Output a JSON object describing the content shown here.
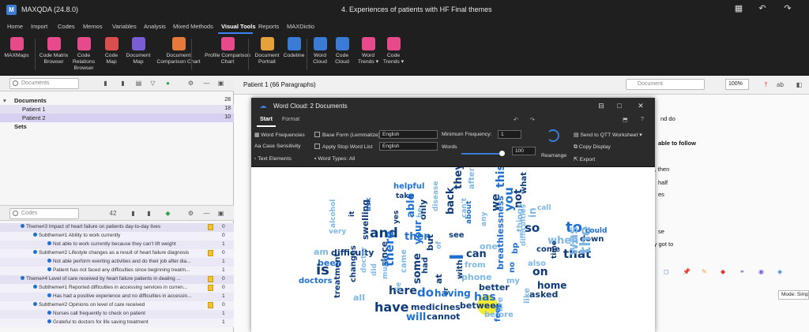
{
  "app": {
    "title": "MAXQDA (24.8.0)",
    "logo": "M",
    "document_title": "4. Experiences of patients with HF Final themes"
  },
  "menu": [
    "Home",
    "Import",
    "Codes",
    "Memos",
    "Variables",
    "Analysis",
    "Mixed Methods",
    "Visual Tools",
    "Reports",
    "MAXDictio"
  ],
  "menu_active": "Visual Tools",
  "ribbon": [
    {
      "label": "MAXMaps",
      "icon": "maxmaps-icon",
      "color": "#e64a8a"
    },
    {
      "label": "Code Matrix\nBrowser",
      "icon": "code-matrix-icon",
      "color": "#e64a8a"
    },
    {
      "label": "Code Relations\nBrowser",
      "icon": "code-relations-icon",
      "color": "#e64a8a"
    },
    {
      "label": "Code\nMap",
      "icon": "code-map-icon",
      "color": "#d94f4f"
    },
    {
      "label": "Document\nMap",
      "icon": "document-map-icon",
      "color": "#7a5cd6"
    },
    {
      "label": "Document\nComparison Chart",
      "icon": "comparison-chart-icon",
      "color": "#e57a3a"
    },
    {
      "label": "Profile Comparison\nChart",
      "icon": "profile-comparison-icon",
      "color": "#e64a8a"
    },
    {
      "label": "Document\nPortrait",
      "icon": "document-portrait-icon",
      "color": "#e6a23a"
    },
    {
      "label": "Codeline",
      "icon": "codeline-icon",
      "color": "#3a7bd5"
    },
    {
      "label": "Word\nCloud",
      "icon": "word-cloud-icon",
      "color": "#3a7bd5"
    },
    {
      "label": "Code\nCloud",
      "icon": "code-cloud-icon",
      "color": "#3a7bd5"
    },
    {
      "label": "Word\nTrends ▾",
      "icon": "word-trends-icon",
      "color": "#e64a8a"
    },
    {
      "label": "Code\nTrends ▾",
      "icon": "code-trends-icon",
      "color": "#e64a8a"
    }
  ],
  "documents": {
    "search_placeholder": "Documents",
    "root": {
      "label": "Documents",
      "count": "28"
    },
    "items": [
      {
        "label": "Patient 1",
        "count": "18"
      },
      {
        "label": "Patient 2",
        "count": "10"
      }
    ],
    "sets": "Sets"
  },
  "codes": {
    "search_placeholder": "Codes",
    "badge": "42",
    "rows": [
      {
        "label": "Theme#3 Impact of heart failure on patients day-to-day lives",
        "count": "0",
        "indent": 1,
        "memo": true
      },
      {
        "label": "Subtheme#1 Ability to work currently",
        "count": "0",
        "indent": 2,
        "memo": false
      },
      {
        "label": "Not able to work currently because they can't lift weight",
        "count": "1",
        "indent": 3,
        "memo": false
      },
      {
        "label": "Subtheme#2 Lifestyle changes as a result of heart failure diagnosis",
        "count": "0",
        "indent": 2,
        "memo": true
      },
      {
        "label": "Not able perform everting activities and do their job after dia...",
        "count": "1",
        "indent": 3,
        "memo": false
      },
      {
        "label": "Patient has not faced any difficulties since beginning treatm...",
        "count": "1",
        "indent": 3,
        "memo": false
      },
      {
        "label": "Theme#4 Level of care received  by heart failure patients in  dealing ...",
        "count": "0",
        "indent": 1,
        "memo": true
      },
      {
        "label": "Subtheme#1 Reported difficulties in accessing services in curren...",
        "count": "0",
        "indent": 2,
        "memo": true
      },
      {
        "label": "Has had a positive experience and no difficulties in accessin...",
        "count": "1",
        "indent": 3,
        "memo": false
      },
      {
        "label": "Subtheme#2 Opinions on level of care received",
        "count": "0",
        "indent": 2,
        "memo": true
      },
      {
        "label": "Nurses call frequently to check on patient",
        "count": "1",
        "indent": 3,
        "memo": false
      },
      {
        "label": "Grateful to doctors for life saving treatment",
        "count": "1",
        "indent": 3,
        "memo": false
      }
    ]
  },
  "doc_view": {
    "title": "Patient 1  (66 Paragraphs)",
    "search_placeholder": "Document",
    "zoom": "100%",
    "snippets": [
      "nd do",
      "able to follow",
      "), then",
      "half",
      "es",
      "se",
      "ly got to"
    ],
    "mode": "Mode: Simp"
  },
  "word_cloud": {
    "title": "Word Cloud: 2 Documents",
    "tabs": [
      "Start",
      "Format"
    ],
    "active_tab": "Start",
    "word_frequencies": "Word Frequencies",
    "case_sensitivity": "Case Sensitivity",
    "text_elements": "Text Elements",
    "base_form": "Base Form (Lemmatize)",
    "stop_list": "Apply Stop Word List",
    "lang1": "English",
    "lang2": "English",
    "word_types": "Word Types: All",
    "min_freq_label": "Minimum Frequency:",
    "min_freq": "1",
    "words_label": "Words",
    "words": "100",
    "rearrange": "Rearrange",
    "send_qtt": "Send to QTT Worksheet",
    "copy_display": "Copy Display",
    "export": "Export",
    "words_list": [
      [
        "helpful",
        "#1f6fd1"
      ],
      [
        "take",
        "#0d3b7a"
      ],
      [
        "able",
        "#1f6fd1"
      ],
      [
        "only",
        "#0d3b7a"
      ],
      [
        "disease",
        "#7fb8e6"
      ],
      [
        "back",
        "#0d3b7a"
      ],
      [
        "they",
        "#0d3b7a"
      ],
      [
        "after",
        "#7fb8e6"
      ],
      [
        "this",
        "#1f6fd1"
      ],
      [
        "what",
        "#0d3b7a"
      ],
      [
        "call",
        "#7fb8e6"
      ],
      [
        "alcohol",
        "#7fb8e6"
      ],
      [
        "it",
        "#0d3b7a"
      ],
      [
        "ask",
        "#1f6fd1"
      ],
      [
        "yes",
        "#0d3b7a"
      ],
      [
        "be",
        "#7fb8e6"
      ],
      [
        "can't",
        "#7fb8e6"
      ],
      [
        "about",
        "#1f6fd1"
      ],
      [
        "any",
        "#7fb8e6"
      ],
      [
        "we",
        "#0d3b7a"
      ],
      [
        "you",
        "#1f6fd1"
      ],
      [
        "not",
        "#0d3b7a"
      ],
      [
        "in",
        "#7fb8e6"
      ],
      [
        "very",
        "#7fb8e6"
      ],
      [
        "swelling",
        "#0d3b7a"
      ],
      [
        "and",
        "#0d3b7a"
      ],
      [
        "then",
        "#1f6fd1"
      ],
      [
        "see",
        "#0d3b7a"
      ],
      [
        "so",
        "#0d3b7a"
      ],
      [
        "to",
        "#1f6fd1"
      ],
      [
        "difficulty",
        "#0d3b7a"
      ],
      [
        "been",
        "#1f6fd1"
      ],
      [
        "your",
        "#1f6fd1"
      ],
      [
        "but",
        "#0d3b7a"
      ],
      [
        "of",
        "#7fb8e6"
      ],
      [
        "I",
        "#1f6fd1"
      ],
      [
        "can",
        "#0d3b7a"
      ],
      [
        "when",
        "#7fb8e6"
      ],
      [
        "down",
        "#0d3b7a"
      ],
      [
        "am",
        "#7fb8e6"
      ],
      [
        "that",
        "#0d3b7a"
      ],
      [
        "come",
        "#0d3b7a"
      ],
      [
        "is",
        "#0d3b7a"
      ],
      [
        "changes",
        "#0d3b7a"
      ],
      [
        "doctor",
        "#7fb8e6"
      ],
      [
        "since",
        "#0d3b7a"
      ],
      [
        "the",
        "#7fb8e6"
      ],
      [
        "was",
        "#7fb8e6"
      ],
      [
        "doctors",
        "#1f6fd1"
      ],
      [
        "treatment",
        "#0d3b7a"
      ],
      [
        "there",
        "#1f6fd1"
      ],
      [
        "came",
        "#7fb8e6"
      ],
      [
        "some",
        "#0d3b7a"
      ],
      [
        "had",
        "#0d3b7a"
      ],
      [
        "from",
        "#7fb8e6"
      ],
      [
        "on",
        "#0d3b7a"
      ],
      [
        "also",
        "#7fb8e6"
      ],
      [
        "no",
        "#1f6fd1"
      ],
      [
        "home",
        "#0d3b7a"
      ],
      [
        "or",
        "#0d3b7a"
      ],
      [
        "here",
        "#0d3b7a"
      ],
      [
        "do",
        "#1f6fd1"
      ],
      [
        "having",
        "#1f6fd1"
      ],
      [
        "phone",
        "#7fb8e6"
      ],
      [
        "better",
        "#0d3b7a"
      ],
      [
        "has",
        "#1f6fd1"
      ],
      [
        "asked",
        "#0d3b7a"
      ],
      [
        "all",
        "#7fb8e6"
      ],
      [
        "have",
        "#0d3b7a"
      ],
      [
        "lie",
        "#7fb8e6"
      ],
      [
        "medicines",
        "#0d3b7a"
      ],
      [
        "between",
        "#0d3b7a"
      ],
      [
        "like",
        "#7fb8e6"
      ],
      [
        "will",
        "#1f6fd1"
      ],
      [
        "cannot",
        "#0d3b7a"
      ],
      [
        "things",
        "#7fb8e6"
      ],
      [
        "difficulties",
        "#7fb8e6"
      ],
      [
        "breathlessness",
        "#1f6fd1"
      ],
      [
        "time",
        "#0d3b7a"
      ],
      [
        "did",
        "#7fb8e6"
      ],
      [
        "much",
        "#7fb8e6"
      ],
      [
        "with",
        "#0d3b7a"
      ],
      [
        "at",
        "#0d3b7a"
      ],
      [
        "my",
        "#7fb8e6"
      ],
      [
        "bp",
        "#1f6fd1"
      ],
      [
        "are",
        "#7fb8e6"
      ],
      [
        "before",
        "#7fb8e6"
      ],
      [
        "feel",
        "#1f6fd1"
      ],
      [
        "one",
        "#7fb8e6"
      ],
      [
        "could",
        "#1f6fd1"
      ]
    ]
  }
}
